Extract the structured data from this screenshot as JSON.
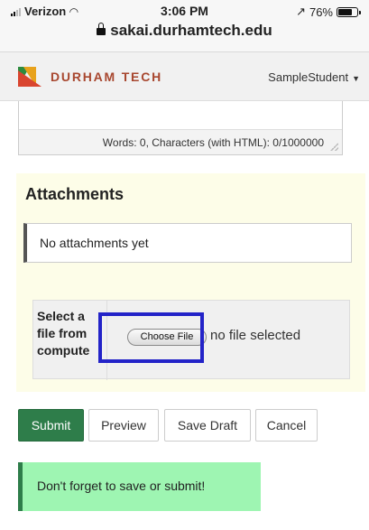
{
  "status_bar": {
    "carrier": "Verizon",
    "time": "3:06 PM",
    "battery_text": "76%",
    "battery_level": 0.76,
    "url": "sakai.durhamtech.edu"
  },
  "header": {
    "logo_text": "DURHAM TECH",
    "username": "SampleStudent",
    "colors": {
      "logo_text": "#a8472f",
      "green": "#2e8b3e",
      "orange": "#e8a21c",
      "red": "#d9452f"
    }
  },
  "editor": {
    "word_count": "Words: 0, Characters (with HTML): 0/1000000"
  },
  "attachments": {
    "title": "Attachments",
    "empty_message": "No attachments yet",
    "file_label": "Select a file from compute",
    "choose_file_label": "Choose File",
    "no_file_text": "no file selected"
  },
  "actions": {
    "submit": "Submit",
    "preview": "Preview",
    "save_draft": "Save Draft",
    "cancel": "Cancel"
  },
  "reminder": "Don't forget to save or submit!",
  "colors": {
    "submit_bg": "#2e7d4a",
    "panel_bg": "#fdfde8",
    "reminder_bg": "#9ef5b2",
    "highlight_border": "#2323c8"
  }
}
